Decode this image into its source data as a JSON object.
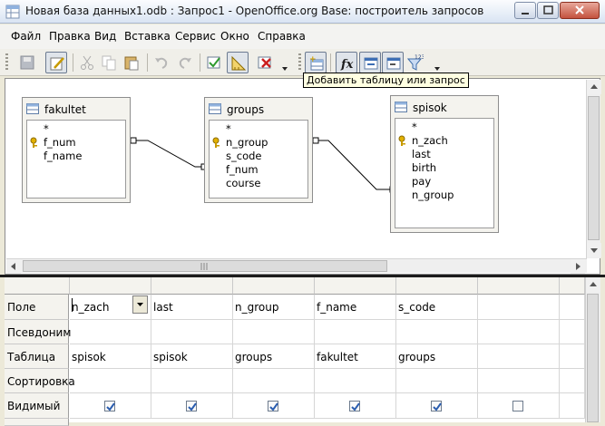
{
  "window": {
    "title": "Новая база данных1.odb : Запрос1 - OpenOffice.org Base: построитель запросов"
  },
  "menu": [
    "Файл",
    "Правка",
    "Вид",
    "Вставка",
    "Сервис",
    "Окно",
    "Справка"
  ],
  "tooltip": "Добавить таблицу или запрос",
  "tables": [
    {
      "name": "fakultet",
      "fields": [
        "*",
        "f_num",
        "f_name"
      ],
      "key_index": 1
    },
    {
      "name": "groups",
      "fields": [
        "*",
        "n_group",
        "s_code",
        "f_num",
        "course"
      ],
      "key_index": 1
    },
    {
      "name": "spisok",
      "fields": [
        "*",
        "n_zach",
        "last",
        "birth",
        "pay",
        "n_group"
      ],
      "key_index": 1
    }
  ],
  "grid": {
    "row_labels": [
      "Поле",
      "Псевдоним",
      "Таблица",
      "Сортировка",
      "Видимый"
    ],
    "columns": [
      {
        "field": "n_zach",
        "alias": "",
        "table": "spisok",
        "sort": "",
        "visible": true
      },
      {
        "field": "last",
        "alias": "",
        "table": "spisok",
        "sort": "",
        "visible": true
      },
      {
        "field": "n_group",
        "alias": "",
        "table": "groups",
        "sort": "",
        "visible": true
      },
      {
        "field": "f_name",
        "alias": "",
        "table": "fakultet",
        "sort": "",
        "visible": true
      },
      {
        "field": "s_code",
        "alias": "",
        "table": "groups",
        "sort": "",
        "visible": true
      },
      {
        "field": "",
        "alias": "",
        "table": "",
        "sort": "",
        "visible": false
      }
    ]
  },
  "icons": {
    "toolbar": [
      "save-icon",
      "edit-mode-icon",
      "cut-icon",
      "copy-icon",
      "paste-icon",
      "undo-icon",
      "redo-icon",
      "run-query-icon",
      "design-view-icon",
      "clear-query-icon",
      "add-table-icon",
      "functions-icon",
      "table-name-icon",
      "alias-icon",
      "distinct-values-icon"
    ]
  },
  "function_glyph": "fx",
  "distinct_label": "123",
  "colors": {
    "check": "#2a5db0",
    "key": "#d8a200",
    "accent": "#2b5797"
  }
}
